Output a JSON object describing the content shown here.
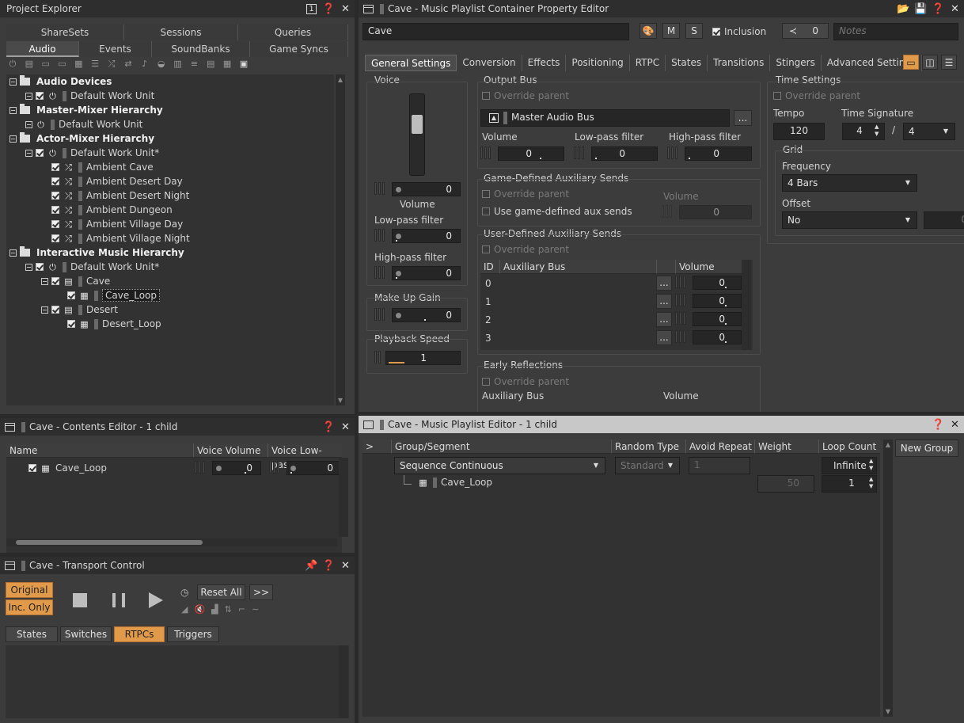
{
  "project_explorer": {
    "title": "Project Explorer",
    "pin_label": "1",
    "tabs_row1": [
      "ShareSets",
      "Sessions",
      "Queries"
    ],
    "tabs_row2": [
      "Audio",
      "Events",
      "SoundBanks",
      "Game Syncs"
    ],
    "tree": [
      {
        "label": "Audio Devices",
        "bold": true,
        "level": 0,
        "type": "folder"
      },
      {
        "label": "Default Work Unit",
        "level": 1,
        "type": "wu",
        "chk": true
      },
      {
        "label": "Master-Mixer Hierarchy",
        "bold": true,
        "level": 0,
        "type": "folder"
      },
      {
        "label": "Default Work Unit",
        "level": 1,
        "type": "wu",
        "chk": false
      },
      {
        "label": "Actor-Mixer Hierarchy",
        "bold": true,
        "level": 0,
        "type": "folder"
      },
      {
        "label": "Default Work Unit*",
        "level": 1,
        "type": "wu",
        "chk": true
      },
      {
        "label": "Ambient Cave",
        "level": 2,
        "type": "rnd"
      },
      {
        "label": "Ambient Desert Day",
        "level": 2,
        "type": "rnd"
      },
      {
        "label": "Ambient Desert Night",
        "level": 2,
        "type": "rnd"
      },
      {
        "label": "Ambient Dungeon",
        "level": 2,
        "type": "rnd"
      },
      {
        "label": "Ambient Village Day",
        "level": 2,
        "type": "rnd"
      },
      {
        "label": "Ambient Village Night",
        "level": 2,
        "type": "rnd"
      },
      {
        "label": "Interactive Music Hierarchy",
        "bold": true,
        "level": 0,
        "type": "folder"
      },
      {
        "label": "Default Work Unit*",
        "level": 1,
        "type": "wu",
        "chk": true
      },
      {
        "label": "Cave",
        "level": 2,
        "type": "pl"
      },
      {
        "label": "Cave_Loop",
        "level": 3,
        "type": "seg",
        "selected": true
      },
      {
        "label": "Desert",
        "level": 2,
        "type": "pl"
      },
      {
        "label": "Desert_Loop",
        "level": 3,
        "type": "seg"
      }
    ]
  },
  "contents_editor": {
    "title": "Cave - Contents Editor - 1 child",
    "columns": [
      "Name",
      "Voice Volume",
      "Voice Low-pass"
    ],
    "rows": [
      {
        "name": "Cave_Loop",
        "volume": "0",
        "lowpass": "0"
      }
    ]
  },
  "transport": {
    "title": "Cave - Transport Control",
    "original": "Original",
    "inc_only": "Inc. Only",
    "reset_all": "Reset All",
    "more": ">>",
    "tabs": [
      "States",
      "Switches",
      "RTPCs",
      "Triggers"
    ]
  },
  "property_editor": {
    "title": "Cave - Music Playlist Container Property Editor",
    "name": "Cave",
    "m": "M",
    "s": "S",
    "inclusion": "Inclusion",
    "share_count": "0",
    "notes_placeholder": "Notes",
    "tabs": [
      "General Settings",
      "Conversion",
      "Effects",
      "Positioning",
      "RTPC",
      "States",
      "Transitions",
      "Stingers",
      "Advanced Settings",
      "+"
    ],
    "voice": {
      "title": "Voice",
      "volume_label": "Volume",
      "volume": "0",
      "lowpass_label": "Low-pass filter",
      "lowpass": "0",
      "highpass_label": "High-pass filter",
      "highpass": "0",
      "makeup_label": "Make-Up Gain",
      "makeup": "0",
      "speed_label": "Playback Speed",
      "speed": "1"
    },
    "output_bus": {
      "title": "Output Bus",
      "override": "Override parent",
      "bus": "Master Audio Bus",
      "ellipsis": "...",
      "volume_label": "Volume",
      "volume": "0",
      "lowpass_label": "Low-pass filter",
      "lowpass": "0",
      "highpass_label": "High-pass filter",
      "highpass": "0"
    },
    "game_aux": {
      "title": "Game-Defined Auxiliary Sends",
      "override": "Override parent",
      "use": "Use game-defined aux sends",
      "volume_label": "Volume",
      "volume": "0"
    },
    "user_aux": {
      "title": "User-Defined Auxiliary Sends",
      "override": "Override parent",
      "cols": [
        "ID",
        "Auxiliary Bus",
        "Volume"
      ],
      "rows": [
        {
          "id": "0",
          "vol": "0"
        },
        {
          "id": "1",
          "vol": "0"
        },
        {
          "id": "2",
          "vol": "0"
        },
        {
          "id": "3",
          "vol": "0"
        }
      ]
    },
    "early": {
      "title": "Early Reflections",
      "override": "Override parent",
      "aux_label": "Auxiliary Bus",
      "volume_label": "Volume"
    },
    "time": {
      "title": "Time Settings",
      "override": "Override parent",
      "tempo_label": "Tempo",
      "tempo": "120",
      "sig_label": "Time Signature",
      "sig_num": "4",
      "sig_slash": "/",
      "sig_den": "4",
      "grid_title": "Grid",
      "freq_label": "Frequency",
      "freq": "4 Bars",
      "offset_label": "Offset",
      "offset": "No",
      "offset_val": "0"
    }
  },
  "playlist_editor": {
    "title": "Cave - Music Playlist Editor - 1 child",
    "expand": ">",
    "columns": [
      "Group/Segment",
      "Random Type",
      "Avoid Repeat",
      "Weight",
      "Loop Count"
    ],
    "group": {
      "name": "Sequence Continuous",
      "random": "Standard",
      "avoid": "1",
      "loop": "Infinite"
    },
    "segment": {
      "name": "Cave_Loop",
      "weight": "50",
      "loop": "1"
    },
    "new_group": "New Group"
  }
}
